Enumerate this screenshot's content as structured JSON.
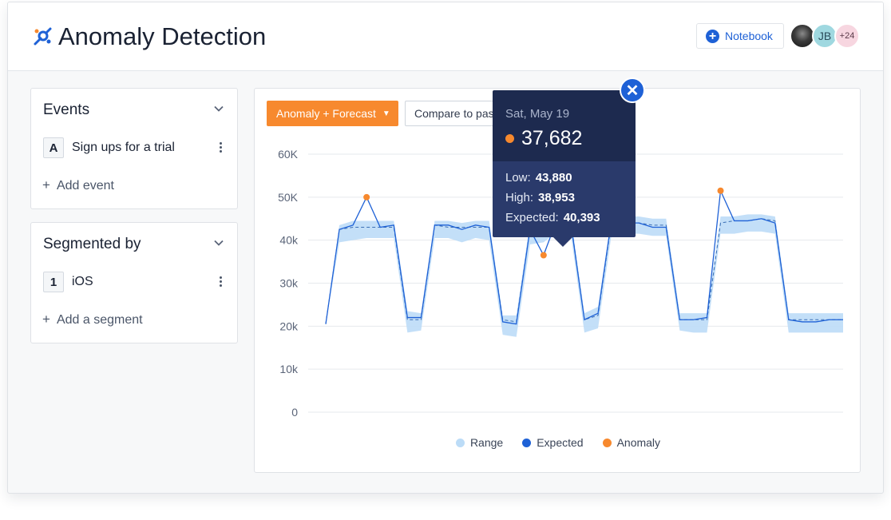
{
  "header": {
    "title": "Anomaly Detection",
    "notebook_label": "Notebook",
    "avatars": [
      {
        "type": "photo",
        "label": ""
      },
      {
        "type": "initials",
        "label": "JB"
      },
      {
        "type": "more",
        "label": "+24"
      }
    ]
  },
  "events_panel": {
    "title": "Events",
    "items": [
      {
        "badge": "A",
        "label": "Sign ups for a trial"
      }
    ],
    "add_label": "Add event"
  },
  "segment_panel": {
    "title": "Segmented by",
    "items": [
      {
        "badge": "1",
        "label": "iOS"
      }
    ],
    "add_label": "Add a segment"
  },
  "controls": {
    "mode_label": "Anomaly + Forecast",
    "compare_label": "Compare to past"
  },
  "tooltip": {
    "date": "Sat, May 19",
    "value": "37,682",
    "low_label": "Low:",
    "low_value": "43,880",
    "high_label": "High:",
    "high_value": "38,953",
    "expected_label": "Expected:",
    "expected_value": "40,393"
  },
  "colors": {
    "accent": "#1e61d6",
    "orange": "#f7892e",
    "range": "#bcdcf7",
    "expected": "#1e61d6",
    "tooltip_dark": "#1d2a4f"
  },
  "chart_data": {
    "type": "line",
    "ylim": [
      0,
      60000
    ],
    "y_ticks": [
      "0",
      "10k",
      "20k",
      "30k",
      "40k",
      "50K",
      "60K"
    ],
    "grid": true,
    "legend_position": "bottom",
    "legend": [
      {
        "label": "Range",
        "color": "#bcdcf7"
      },
      {
        "label": "Expected",
        "color": "#1e61d6"
      },
      {
        "label": "Anomaly",
        "color": "#f7892e"
      }
    ],
    "x": [
      0,
      1,
      2,
      3,
      4,
      5,
      6,
      7,
      8,
      9,
      10,
      11,
      12,
      13,
      14,
      15,
      16,
      17,
      18,
      19,
      20,
      21,
      22,
      23,
      24,
      25,
      26,
      27,
      28,
      29,
      30,
      31,
      32,
      33,
      34,
      35,
      36,
      37,
      38
    ],
    "actual": [
      20500,
      42500,
      43500,
      50000,
      43000,
      43500,
      22000,
      22000,
      43500,
      43500,
      42500,
      43500,
      43000,
      21000,
      20500,
      42500,
      36500,
      45000,
      44000,
      21500,
      23000,
      45000,
      44000,
      44000,
      43000,
      43000,
      21500,
      21500,
      22000,
      51500,
      44500,
      44500,
      45000,
      44000,
      21500,
      21000,
      21000,
      21500,
      21500
    ],
    "expected": [
      20500,
      42500,
      43000,
      43000,
      43000,
      43000,
      21500,
      21500,
      43500,
      43000,
      43000,
      43000,
      43000,
      21500,
      21000,
      42500,
      42000,
      44500,
      44500,
      21500,
      22500,
      44500,
      44500,
      44000,
      43500,
      43500,
      21500,
      21500,
      21500,
      44000,
      44500,
      44500,
      45000,
      44500,
      21500,
      21500,
      21500,
      21500,
      21500
    ],
    "range_low": [
      20500,
      39500,
      40000,
      40500,
      40500,
      40500,
      18500,
      19000,
      40500,
      40500,
      39500,
      40500,
      40000,
      18000,
      17500,
      39000,
      39500,
      42000,
      41500,
      18500,
      19500,
      41500,
      41500,
      41500,
      41000,
      41000,
      19000,
      18500,
      18500,
      41500,
      41500,
      42000,
      42000,
      41500,
      18500,
      18500,
      18500,
      18500,
      18500
    ],
    "range_high": [
      20500,
      43500,
      44500,
      44500,
      44500,
      44500,
      23500,
      23000,
      44500,
      44500,
      44000,
      44500,
      44500,
      22500,
      22500,
      44000,
      43500,
      46000,
      45500,
      23000,
      24500,
      45500,
      45500,
      45500,
      45000,
      45000,
      23000,
      23000,
      23000,
      45500,
      45500,
      46000,
      46000,
      45500,
      23000,
      23000,
      23000,
      23000,
      23000
    ],
    "anomalies": [
      {
        "x": 3,
        "y": 50000
      },
      {
        "x": 16,
        "y": 36500
      },
      {
        "x": 29,
        "y": 51500
      }
    ]
  }
}
